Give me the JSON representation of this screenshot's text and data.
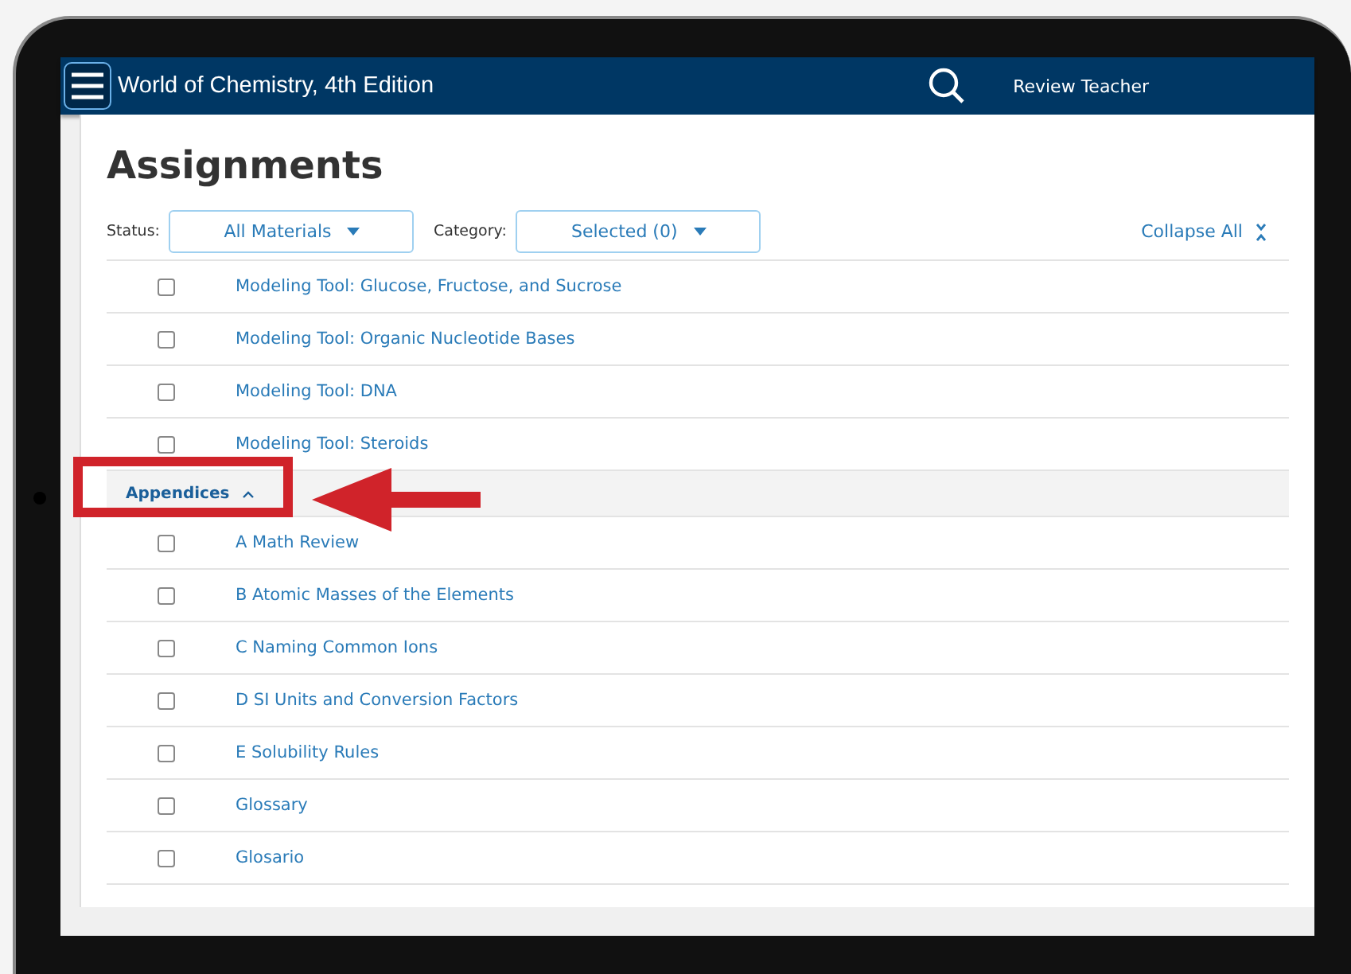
{
  "header": {
    "title": "World of Chemistry, 4th Edition",
    "user": "Review Teacher"
  },
  "page": {
    "title": "Assignments"
  },
  "filters": {
    "status_label": "Status:",
    "status_value": "All Materials",
    "category_label": "Category:",
    "category_value": "Selected (0)",
    "collapse_all": "Collapse All"
  },
  "items": [
    {
      "kind": "item",
      "label": "Modeling Tool: Glucose, Fructose, and Sucrose",
      "checked": false
    },
    {
      "kind": "item",
      "label": "Modeling Tool: Organic Nucleotide Bases",
      "checked": false
    },
    {
      "kind": "item",
      "label": "Modeling Tool: DNA",
      "checked": false
    },
    {
      "kind": "item",
      "label": "Modeling Tool: Steroids",
      "checked": false
    },
    {
      "kind": "section",
      "label": "Appendices",
      "expanded": true
    },
    {
      "kind": "item",
      "label": "A Math Review",
      "checked": false
    },
    {
      "kind": "item",
      "label": "B Atomic Masses of the Elements",
      "checked": false
    },
    {
      "kind": "item",
      "label": "C Naming Common Ions",
      "checked": false
    },
    {
      "kind": "item",
      "label": "D SI Units and Conversion Factors",
      "checked": false
    },
    {
      "kind": "item",
      "label": "E Solubility Rules",
      "checked": false
    },
    {
      "kind": "item",
      "label": "Glossary",
      "checked": false
    },
    {
      "kind": "item",
      "label": "Glosario",
      "checked": false
    }
  ]
}
